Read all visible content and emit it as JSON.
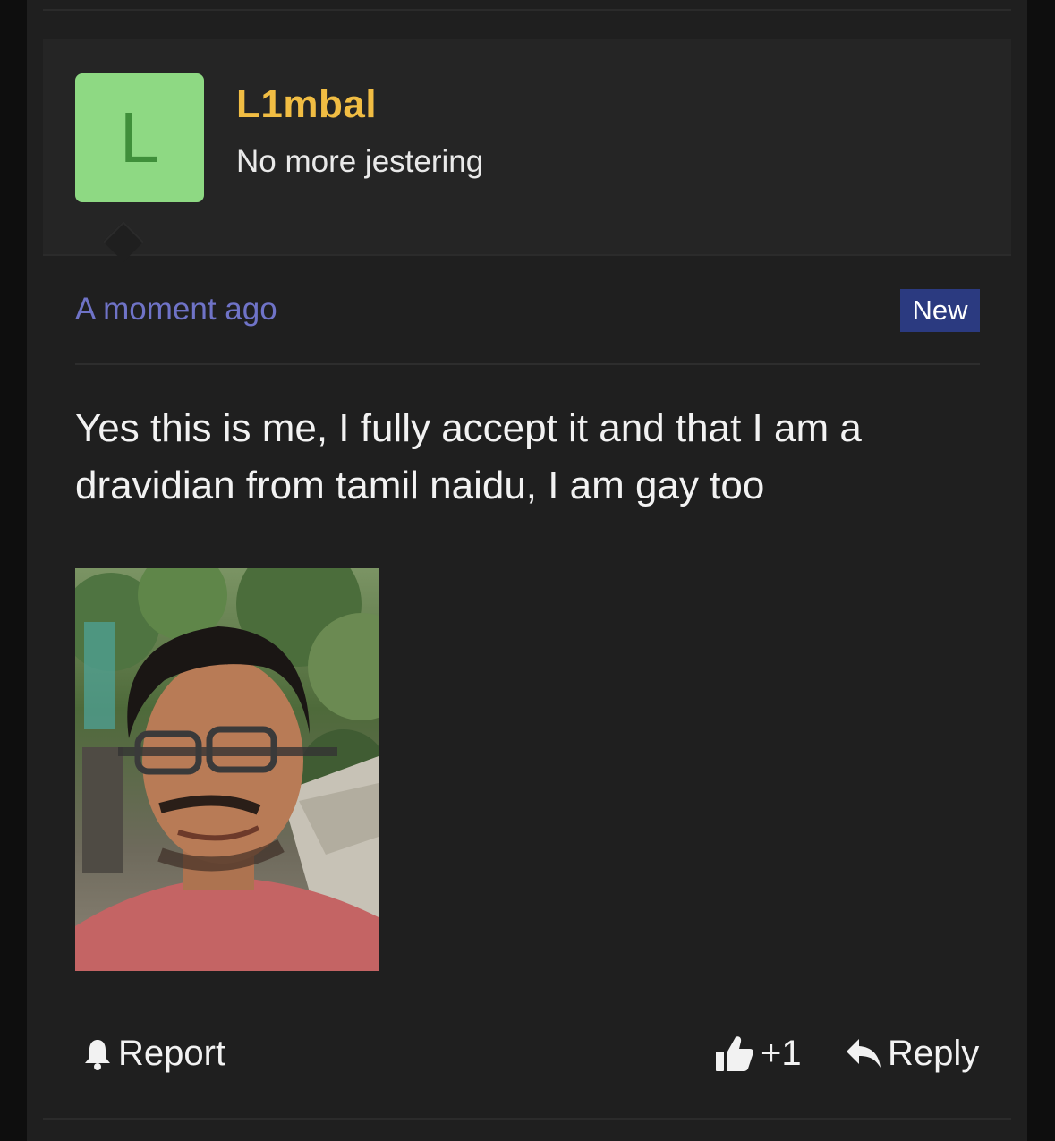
{
  "post": {
    "author": {
      "avatar_letter": "L",
      "avatar_color": "#8ed983",
      "name": "L1mbal",
      "name_color": "#f1bd43",
      "title": "No more jestering"
    },
    "timestamp": "A moment ago",
    "badge": "New",
    "message": "Yes this is me, I fully accept it and that I am a dravidian from tamil naidu, I am gay too",
    "attachment_icon": "photo-attachment",
    "actions": {
      "report_label": "Report",
      "like_count": "+1",
      "reply_label": "Reply"
    }
  },
  "colors": {
    "background": "#0e0e0e",
    "panel": "#1f1f1f",
    "header_panel": "#252525",
    "link": "#6f73c7",
    "badge": "#2b3a80"
  }
}
